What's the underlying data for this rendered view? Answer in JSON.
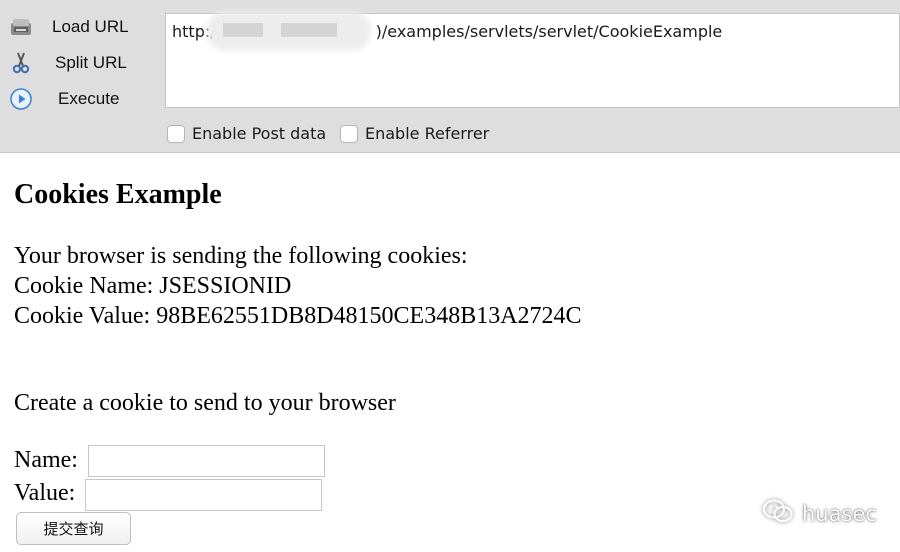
{
  "toolbar": {
    "load_url_label": "Load URL",
    "split_url_label": "Split URL",
    "execute_label": "Execute",
    "url_prefix": "http:/",
    "url_suffix": ")/examples/servlets/servlet/CookieExample",
    "enable_post_label": "Enable Post data",
    "enable_referrer_label": "Enable Referrer",
    "icons": {
      "load": "load-url-icon",
      "split": "scissors-icon",
      "execute": "play-icon"
    },
    "accent_color": "#3b82d6"
  },
  "page": {
    "title": "Cookies Example",
    "intro": "Your browser is sending the following cookies:",
    "cookie_name_line": "Cookie Name: JSESSIONID",
    "cookie_value_line": "Cookie Value: 98BE62551DB8D48150CE348B13A2724C",
    "create_heading": "Create a cookie to send to your browser",
    "name_label": "Name:",
    "value_label": "Value:",
    "name_value": "",
    "value_value": "",
    "submit_label": "提交查询"
  },
  "watermark": {
    "text": "huasec",
    "icon": "wechat-icon"
  }
}
